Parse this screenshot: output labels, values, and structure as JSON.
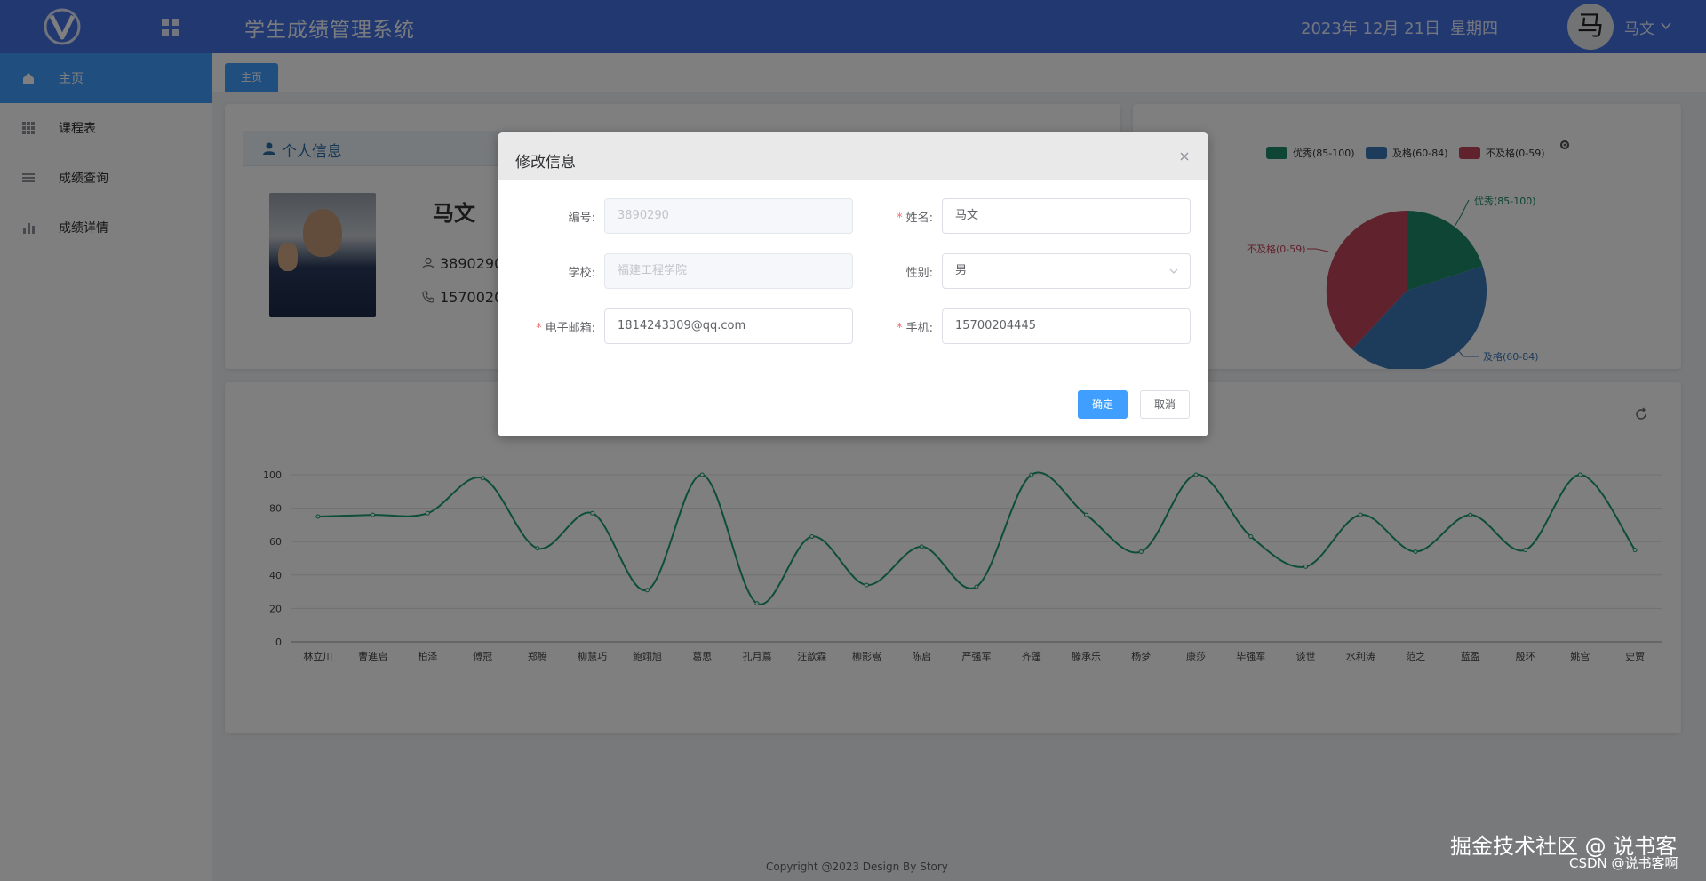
{
  "header": {
    "title": "学生成绩管理系统",
    "date": "2023年 12月 21日",
    "weekday": "星期四",
    "avatar_char": "马",
    "user_name": "马文"
  },
  "sidebar": {
    "items": [
      {
        "label": "主页",
        "icon": "home-icon",
        "active": true
      },
      {
        "label": "课程表",
        "icon": "grid-icon"
      },
      {
        "label": "成绩查询",
        "icon": "list-icon"
      },
      {
        "label": "成绩详情",
        "icon": "bar-chart-icon"
      }
    ]
  },
  "tabs": [
    {
      "label": "主页"
    }
  ],
  "profile": {
    "section_title": "个人信息",
    "name": "马文",
    "id_partial": "3890290",
    "phone_partial": "1570020"
  },
  "pie": {
    "legend": [
      "优秀(85-100)",
      "及格(60-84)",
      "不及格(0-59)"
    ],
    "colors": [
      "#1e8a6a",
      "#3a78b8",
      "#c0445b"
    ]
  },
  "chart_data": {
    "type": "line",
    "categories": [
      "林立川",
      "曹進启",
      "柏泽",
      "傅冠",
      "郑腾",
      "柳慧巧",
      "鲍翊旭",
      "葛思",
      "孔月蔦",
      "汪歆霖",
      "柳影嵩",
      "陈启",
      "严强军",
      "齐蓬",
      "滕承乐",
      "杨梦",
      "康莎",
      "毕强军",
      "谈世",
      "水利涛",
      "范之",
      "蓝盈",
      "殷环",
      "姚宫",
      "史贾"
    ],
    "values": [
      75,
      76,
      77,
      98,
      56,
      77,
      31,
      100,
      23,
      63,
      34,
      57,
      33,
      100,
      76,
      54,
      100,
      63,
      45,
      76,
      54,
      76,
      55,
      100,
      55
    ],
    "ylim": [
      0,
      100
    ],
    "yticks": [
      0,
      20,
      40,
      60,
      80,
      100
    ],
    "color": "#1a9c72"
  },
  "dialog": {
    "title": "修改信息",
    "fields": {
      "id_label": "编号:",
      "id_value": "3890290",
      "name_label": "姓名:",
      "name_value": "马文",
      "school_label": "学校:",
      "school_value": "福建工程学院",
      "gender_label": "性别:",
      "gender_value": "男",
      "email_label": "电子邮箱:",
      "email_value": "1814243309@qq.com",
      "phone_label": "手机:",
      "phone_value": "15700204445"
    },
    "confirm": "确定",
    "cancel": "取消"
  },
  "footer": "Copyright @2023 Design By Story",
  "watermark": "掘金技术社区 @ 说书客",
  "watermark_sub": "CSDN @说书客啊"
}
